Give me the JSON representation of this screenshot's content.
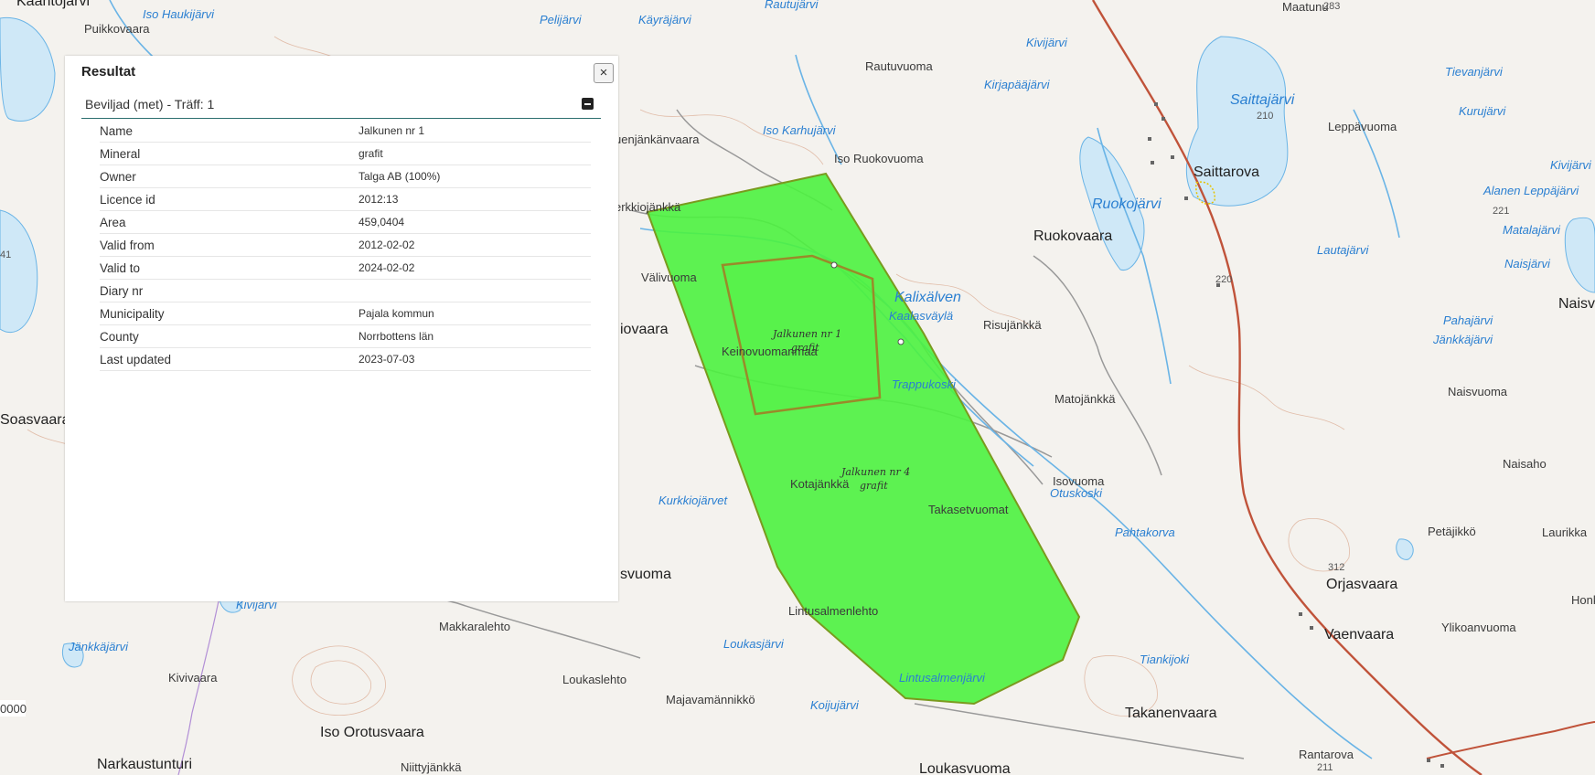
{
  "panel": {
    "title": "Resultat",
    "close_icon": "×",
    "group_title": "Beviljad (met) - Träff: 1",
    "attributes": [
      {
        "key": "Name",
        "value": "Jalkunen nr 1"
      },
      {
        "key": "Mineral",
        "value": "grafit"
      },
      {
        "key": "Owner",
        "value": "Talga AB (100%)"
      },
      {
        "key": "Licence id",
        "value": "2012:13"
      },
      {
        "key": "Area",
        "value": "459,0404"
      },
      {
        "key": "Valid from",
        "value": "2012-02-02"
      },
      {
        "key": "Valid to",
        "value": "2024-02-02"
      },
      {
        "key": "Diary nr",
        "value": ""
      },
      {
        "key": "Municipality",
        "value": "Pajala kommun"
      },
      {
        "key": "County",
        "value": "Norrbottens län"
      },
      {
        "key": "Last updated",
        "value": "2023-07-03"
      }
    ]
  },
  "map": {
    "colors": {
      "land": "#f4f2ee",
      "water": "#cfe8f7",
      "claim_fill": "#4cf23f",
      "claim_stroke": "#7a9a1e",
      "road": "#c0533a",
      "river": "#6ab4e6"
    },
    "claims": [
      {
        "name": "Jalkunen nr 1",
        "mineral": "grafit"
      },
      {
        "name": "Jalkunen nr 4",
        "mineral": "grafit"
      }
    ],
    "place_labels": [
      "Iso Haukijärvi",
      "Puikkovaara",
      "Pelijärvi",
      "Käyräjärvi",
      "Rautujärvi",
      "Maatunu",
      "Rautuvuoma",
      "Kivijärvi",
      "Kirjapääjärvi",
      "Tievanjärvi",
      "Kurujärvi",
      "Leppävuoma",
      "Kivijärvi",
      "Iso Karhujärvi",
      "Iso Ruokovuoma",
      "uenjänkänvaara",
      "Saittarova",
      "Alanen Leppäjärvi",
      "Ruokojärvi",
      "erkkiojänkkä",
      "Matalajärvi",
      "Välivuoma",
      "Ruokovaara",
      "Lautajärvi",
      "Naisjärvi",
      "Naisvaara",
      "Kalixälven",
      "Kaalasväylä",
      "Risujänkkä",
      "Pahajärvi",
      "Jänkkäjärvi",
      "iovaara",
      "Keinovuomanmaa",
      "Trappukoski",
      "Naisvuoma",
      "Matojänkkä",
      "Soasvaara",
      "Isovuoma",
      "Naisaho",
      "Otuskoski",
      "Kotajänkkä",
      "Takasetvuomat",
      "Kurkkiojärvet",
      "Pahtakorva",
      "Petäjikkö",
      "Laurikka",
      "svuoma",
      "Orjasvaara",
      "Honkamä",
      "Kivijärvi",
      "Lintusalmenlehto",
      "Vaenvaara",
      "Ylikoanvuoma",
      "Jänkkäjärvi",
      "Makkaralehto",
      "Loukasjärvi",
      "Tiankijoki",
      "Kivivaara",
      "Loukaslehto",
      "Lintusalmenjärvi",
      "Majavamännikkö",
      "Koijujärvi",
      "Takanenvaara",
      "Iso Orotusvaara",
      "Rantarova",
      "Narkaustunturi",
      "Niittyjänkkä",
      "Loukasvuoma",
      "Saittajärvi",
      "Kaantojärvi"
    ],
    "elevations": [
      "283",
      "210",
      "221",
      "220",
      "312",
      "211",
      "41"
    ],
    "scale_text": "0000"
  }
}
